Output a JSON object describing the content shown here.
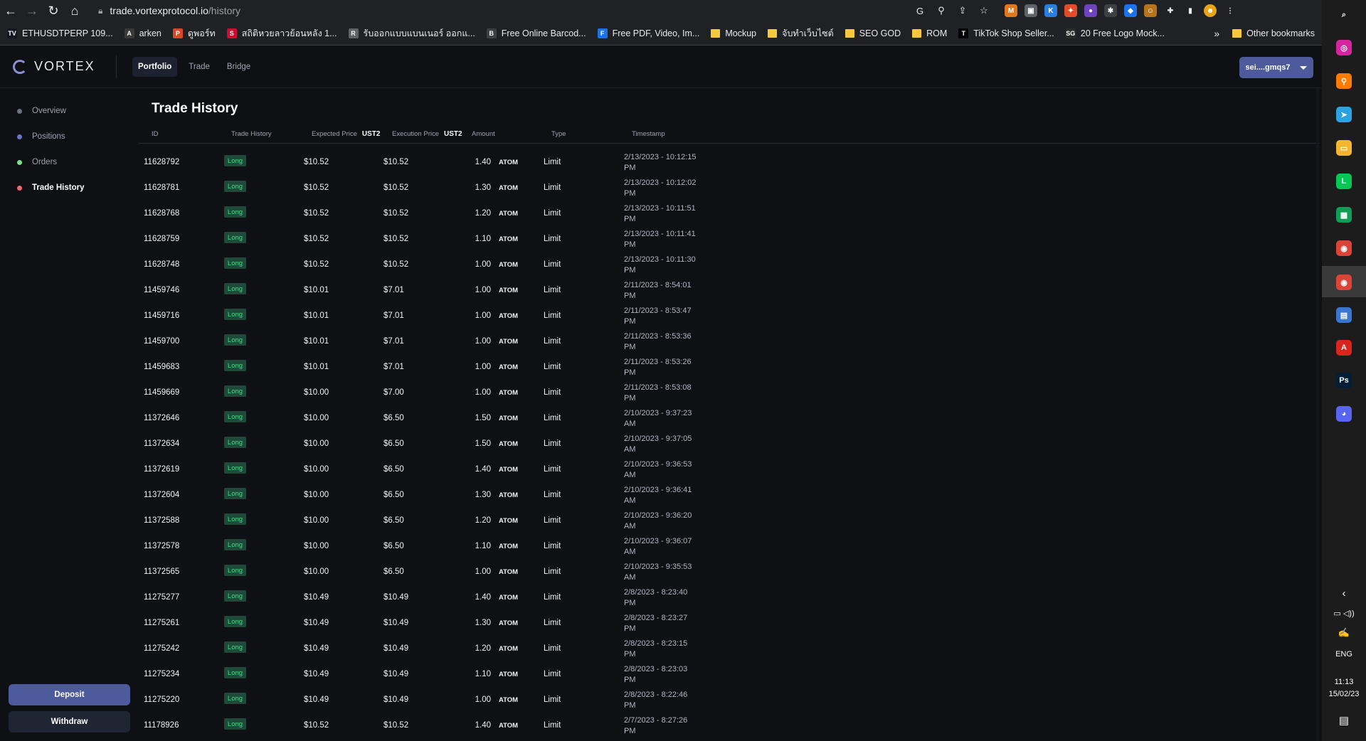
{
  "browser": {
    "url_domain": "trade.vortexprotocol.io",
    "url_path": "/history",
    "bookmarks": [
      {
        "label": "ETHUSDTPERP 109...",
        "icon": "TV",
        "color": "#131722"
      },
      {
        "label": "arken",
        "icon": "A",
        "color": "#3a3a3a"
      },
      {
        "label": "ดูพอร์ท",
        "icon": "P",
        "color": "#d9472b"
      },
      {
        "label": "สถิติหวยลาวย้อนหลัง 1...",
        "icon": "S",
        "color": "#c8102e"
      },
      {
        "label": "รับออกแบบแบนเนอร์ ออกแ...",
        "icon": "R",
        "color": "#5f6368"
      },
      {
        "label": "Free Online Barcod...",
        "icon": "B",
        "color": "#3c4043"
      },
      {
        "label": "Free PDF, Video, Im...",
        "icon": "F",
        "color": "#1a73e8"
      },
      {
        "label": "Mockup",
        "icon": "folder",
        "color": "#f5c842"
      },
      {
        "label": "จับทำเว็บไซต์",
        "icon": "folder",
        "color": "#f5c842"
      },
      {
        "label": "SEO GOD",
        "icon": "folder",
        "color": "#f5c842"
      },
      {
        "label": "ROM",
        "icon": "folder",
        "color": "#f5c842"
      },
      {
        "label": "TikTok Shop Seller...",
        "icon": "T",
        "color": "#000000"
      },
      {
        "label": "20 Free Logo Mock...",
        "icon": "SG",
        "color": "#2b2b2b"
      }
    ],
    "more_label": "»",
    "other_bookmarks": "Other bookmarks"
  },
  "app": {
    "logo_text": "VORTEX",
    "nav": [
      {
        "label": "Portfolio",
        "active": true
      },
      {
        "label": "Trade",
        "active": false
      },
      {
        "label": "Bridge",
        "active": false
      }
    ],
    "wallet_label": "sei....gmqs7"
  },
  "sidebar": {
    "items": [
      {
        "label": "Overview",
        "dot": "#6b7280",
        "active": false
      },
      {
        "label": "Positions",
        "dot": "#6c73c8",
        "active": false
      },
      {
        "label": "Orders",
        "dot": "#7ce08a",
        "active": false
      },
      {
        "label": "Trade History",
        "dot": "#e86a73",
        "active": true
      }
    ],
    "deposit_label": "Deposit",
    "withdraw_label": "Withdraw"
  },
  "main": {
    "title": "Trade History",
    "columns": {
      "id": "ID",
      "trade_history": "Trade History",
      "expected_price": "Expected Price",
      "expected_unit": "UST2",
      "execution_price": "Execution Price",
      "execution_unit": "UST2",
      "amount": "Amount",
      "type": "Type",
      "timestamp": "Timestamp"
    },
    "rows": [
      {
        "id": "11628792",
        "side": "Long",
        "expected": "$10.52",
        "execution": "$10.52",
        "amount": "1.40",
        "asset": "ATOM",
        "type": "Limit",
        "ts1": "2/13/2023 - 10:12:15",
        "ts2": "PM"
      },
      {
        "id": "11628781",
        "side": "Long",
        "expected": "$10.52",
        "execution": "$10.52",
        "amount": "1.30",
        "asset": "ATOM",
        "type": "Limit",
        "ts1": "2/13/2023 - 10:12:02",
        "ts2": "PM"
      },
      {
        "id": "11628768",
        "side": "Long",
        "expected": "$10.52",
        "execution": "$10.52",
        "amount": "1.20",
        "asset": "ATOM",
        "type": "Limit",
        "ts1": "2/13/2023 - 10:11:51",
        "ts2": "PM"
      },
      {
        "id": "11628759",
        "side": "Long",
        "expected": "$10.52",
        "execution": "$10.52",
        "amount": "1.10",
        "asset": "ATOM",
        "type": "Limit",
        "ts1": "2/13/2023 - 10:11:41",
        "ts2": "PM"
      },
      {
        "id": "11628748",
        "side": "Long",
        "expected": "$10.52",
        "execution": "$10.52",
        "amount": "1.00",
        "asset": "ATOM",
        "type": "Limit",
        "ts1": "2/13/2023 - 10:11:30",
        "ts2": "PM"
      },
      {
        "id": "11459746",
        "side": "Long",
        "expected": "$10.01",
        "execution": "$7.01",
        "amount": "1.00",
        "asset": "ATOM",
        "type": "Limit",
        "ts1": "2/11/2023 - 8:54:01",
        "ts2": "PM"
      },
      {
        "id": "11459716",
        "side": "Long",
        "expected": "$10.01",
        "execution": "$7.01",
        "amount": "1.00",
        "asset": "ATOM",
        "type": "Limit",
        "ts1": "2/11/2023 - 8:53:47",
        "ts2": "PM"
      },
      {
        "id": "11459700",
        "side": "Long",
        "expected": "$10.01",
        "execution": "$7.01",
        "amount": "1.00",
        "asset": "ATOM",
        "type": "Limit",
        "ts1": "2/11/2023 - 8:53:36",
        "ts2": "PM"
      },
      {
        "id": "11459683",
        "side": "Long",
        "expected": "$10.01",
        "execution": "$7.01",
        "amount": "1.00",
        "asset": "ATOM",
        "type": "Limit",
        "ts1": "2/11/2023 - 8:53:26",
        "ts2": "PM"
      },
      {
        "id": "11459669",
        "side": "Long",
        "expected": "$10.00",
        "execution": "$7.00",
        "amount": "1.00",
        "asset": "ATOM",
        "type": "Limit",
        "ts1": "2/11/2023 - 8:53:08",
        "ts2": "PM"
      },
      {
        "id": "11372646",
        "side": "Long",
        "expected": "$10.00",
        "execution": "$6.50",
        "amount": "1.50",
        "asset": "ATOM",
        "type": "Limit",
        "ts1": "2/10/2023 - 9:37:23",
        "ts2": "AM"
      },
      {
        "id": "11372634",
        "side": "Long",
        "expected": "$10.00",
        "execution": "$6.50",
        "amount": "1.50",
        "asset": "ATOM",
        "type": "Limit",
        "ts1": "2/10/2023 - 9:37:05",
        "ts2": "AM"
      },
      {
        "id": "11372619",
        "side": "Long",
        "expected": "$10.00",
        "execution": "$6.50",
        "amount": "1.40",
        "asset": "ATOM",
        "type": "Limit",
        "ts1": "2/10/2023 - 9:36:53",
        "ts2": "AM"
      },
      {
        "id": "11372604",
        "side": "Long",
        "expected": "$10.00",
        "execution": "$6.50",
        "amount": "1.30",
        "asset": "ATOM",
        "type": "Limit",
        "ts1": "2/10/2023 - 9:36:41",
        "ts2": "AM"
      },
      {
        "id": "11372588",
        "side": "Long",
        "expected": "$10.00",
        "execution": "$6.50",
        "amount": "1.20",
        "asset": "ATOM",
        "type": "Limit",
        "ts1": "2/10/2023 - 9:36:20",
        "ts2": "AM"
      },
      {
        "id": "11372578",
        "side": "Long",
        "expected": "$10.00",
        "execution": "$6.50",
        "amount": "1.10",
        "asset": "ATOM",
        "type": "Limit",
        "ts1": "2/10/2023 - 9:36:07",
        "ts2": "AM"
      },
      {
        "id": "11372565",
        "side": "Long",
        "expected": "$10.00",
        "execution": "$6.50",
        "amount": "1.00",
        "asset": "ATOM",
        "type": "Limit",
        "ts1": "2/10/2023 - 9:35:53",
        "ts2": "AM"
      },
      {
        "id": "11275277",
        "side": "Long",
        "expected": "$10.49",
        "execution": "$10.49",
        "amount": "1.40",
        "asset": "ATOM",
        "type": "Limit",
        "ts1": "2/8/2023 - 8:23:40",
        "ts2": "PM"
      },
      {
        "id": "11275261",
        "side": "Long",
        "expected": "$10.49",
        "execution": "$10.49",
        "amount": "1.30",
        "asset": "ATOM",
        "type": "Limit",
        "ts1": "2/8/2023 - 8:23:27",
        "ts2": "PM"
      },
      {
        "id": "11275242",
        "side": "Long",
        "expected": "$10.49",
        "execution": "$10.49",
        "amount": "1.20",
        "asset": "ATOM",
        "type": "Limit",
        "ts1": "2/8/2023 - 8:23:15",
        "ts2": "PM"
      },
      {
        "id": "11275234",
        "side": "Long",
        "expected": "$10.49",
        "execution": "$10.49",
        "amount": "1.10",
        "asset": "ATOM",
        "type": "Limit",
        "ts1": "2/8/2023 - 8:23:03",
        "ts2": "PM"
      },
      {
        "id": "11275220",
        "side": "Long",
        "expected": "$10.49",
        "execution": "$10.49",
        "amount": "1.00",
        "asset": "ATOM",
        "type": "Limit",
        "ts1": "2/8/2023 - 8:22:46",
        "ts2": "PM"
      },
      {
        "id": "11178926",
        "side": "Long",
        "expected": "$10.52",
        "execution": "$10.52",
        "amount": "1.40",
        "asset": "ATOM",
        "type": "Limit",
        "ts1": "2/7/2023 - 8:27:26",
        "ts2": "PM"
      }
    ]
  },
  "taskbar": {
    "icons": [
      {
        "name": "search-icon",
        "glyph": "⌕",
        "color": "#1c1c1c"
      },
      {
        "name": "instagram-icon",
        "glyph": "◎",
        "color": "#d6249f"
      },
      {
        "name": "magnifier-app-icon",
        "glyph": "⚲",
        "color": "#ff7a00"
      },
      {
        "name": "telegram-icon",
        "glyph": "➤",
        "color": "#2aa3e0"
      },
      {
        "name": "file-explorer-icon",
        "glyph": "▭",
        "color": "#f2b631"
      },
      {
        "name": "line-icon",
        "glyph": "L",
        "color": "#06c755"
      },
      {
        "name": "sheets-icon",
        "glyph": "▦",
        "color": "#0f9d58"
      },
      {
        "name": "chrome-icon",
        "glyph": "◉",
        "color": "#db4437"
      },
      {
        "name": "chrome-profile-icon",
        "glyph": "◉",
        "color": "#db4437"
      },
      {
        "name": "calculator-icon",
        "glyph": "▤",
        "color": "#3a76d0"
      },
      {
        "name": "acrobat-icon",
        "glyph": "A",
        "color": "#d9251c"
      },
      {
        "name": "photoshop-icon",
        "glyph": "Ps",
        "color": "#001e36"
      },
      {
        "name": "discord-icon",
        "glyph": "◕",
        "color": "#5865f2"
      }
    ],
    "lang": "ENG",
    "time": "11:13",
    "date": "15/02/23"
  }
}
